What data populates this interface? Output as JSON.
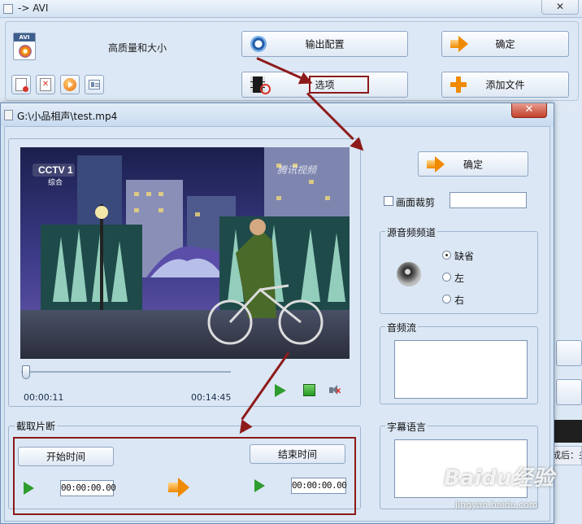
{
  "back_window": {
    "title": "-> AVI",
    "close_glyph": "✕",
    "quality_label": "高质量和大小",
    "avi_tag": "AVI",
    "buttons": {
      "output_config": "输出配置",
      "confirm": "确定",
      "options": "选项",
      "add_file": "添加文件"
    },
    "status_text": "成后：关"
  },
  "dialog": {
    "title": "G:\\小品相声\\test.mp4",
    "close_glyph": "✕",
    "confirm": "确定",
    "crop_label": "画面裁剪",
    "audio_channel": {
      "title": "源音频频道",
      "options": [
        "缺省",
        "左",
        "右"
      ],
      "selected": "缺省"
    },
    "audio_stream_title": "音频流",
    "subtitle_title": "字幕语言",
    "player": {
      "current_time": "00:00:11",
      "total_time": "00:14:45",
      "position_fraction": 0.012
    },
    "clip": {
      "title": "截取片断",
      "start_button": "开始时间",
      "end_button": "结束时间",
      "start_value": "00:00:00.00",
      "end_value": "00:00:00.00"
    },
    "video": {
      "channel_logo": "CCTV 1",
      "channel_sub": "综合",
      "watermark": "腾讯视频"
    }
  },
  "watermark": {
    "brand": "Baidu经验",
    "url": "jingyan.baidu.com"
  },
  "colors": {
    "annotation": "#8e1b1b",
    "accent_orange": "#f08a00",
    "play_green": "#2f9c2f"
  }
}
